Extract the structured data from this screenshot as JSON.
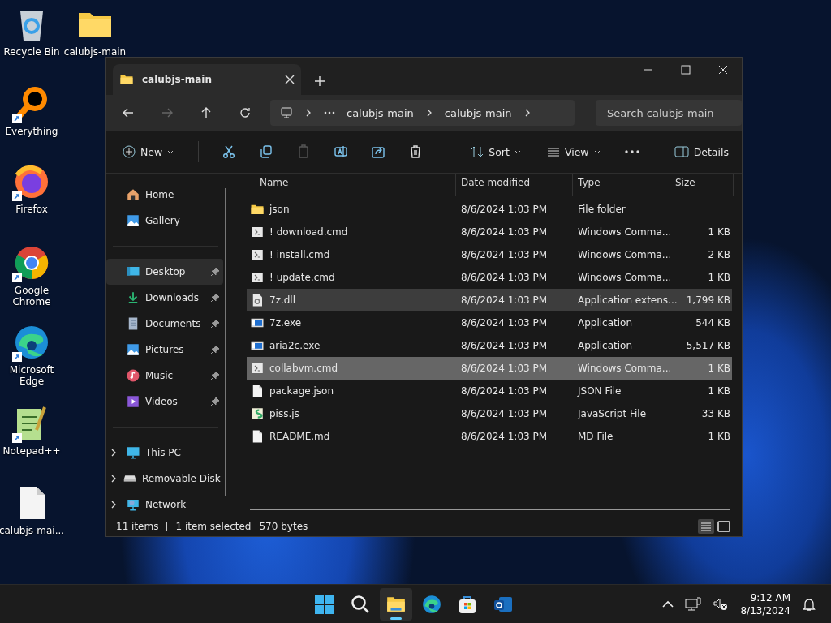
{
  "desktop_icons": [
    {
      "label": "Recycle Bin",
      "kind": "recycle",
      "shortcut": false
    },
    {
      "label": "calubjs-main",
      "kind": "folder",
      "shortcut": false
    },
    {
      "label": "Everything",
      "kind": "everything",
      "shortcut": true
    },
    {
      "label": "Firefox",
      "kind": "firefox",
      "shortcut": true
    },
    {
      "label": "Google Chrome",
      "kind": "chrome",
      "shortcut": true
    },
    {
      "label": "Microsoft Edge",
      "kind": "edge",
      "shortcut": true
    },
    {
      "label": "Notepad++",
      "kind": "notepad",
      "shortcut": true
    },
    {
      "label": "calubjs-mai...",
      "kind": "file",
      "shortcut": false
    }
  ],
  "window": {
    "tab_title": "calubjs-main",
    "breadcrumbs": [
      "calubjs-main",
      "calubjs-main"
    ],
    "search": {
      "placeholder": "Search calubjs-main"
    },
    "toolbar": {
      "new": "New",
      "sort": "Sort",
      "view": "View",
      "details": "Details"
    },
    "sidebar": [
      [
        {
          "label": "Home",
          "kind": "home",
          "pinned": false,
          "expandable": false,
          "selected": false
        },
        {
          "label": "Gallery",
          "kind": "gallery",
          "pinned": false,
          "expandable": false,
          "selected": false
        }
      ],
      [
        {
          "label": "Desktop",
          "kind": "desktop",
          "pinned": true,
          "expandable": false,
          "selected": true
        },
        {
          "label": "Downloads",
          "kind": "downloads",
          "pinned": true,
          "expandable": false,
          "selected": false
        },
        {
          "label": "Documents",
          "kind": "documents",
          "pinned": true,
          "expandable": false,
          "selected": false
        },
        {
          "label": "Pictures",
          "kind": "gallery",
          "pinned": true,
          "expandable": false,
          "selected": false
        },
        {
          "label": "Music",
          "kind": "music",
          "pinned": true,
          "expandable": false,
          "selected": false
        },
        {
          "label": "Videos",
          "kind": "videos",
          "pinned": true,
          "expandable": false,
          "selected": false
        }
      ],
      [
        {
          "label": "This PC",
          "kind": "pc",
          "pinned": false,
          "expandable": true,
          "selected": false
        },
        {
          "label": "Removable Disk",
          "kind": "disk",
          "pinned": false,
          "expandable": true,
          "selected": false
        },
        {
          "label": "Network",
          "kind": "network",
          "pinned": false,
          "expandable": true,
          "selected": false
        }
      ]
    ],
    "columns": [
      "Name",
      "Date modified",
      "Type",
      "Size"
    ],
    "rows": [
      {
        "name": "json",
        "kind": "folder",
        "date": "8/6/2024 1:03 PM",
        "type": "File folder",
        "size": "",
        "selected": false,
        "hovered": false
      },
      {
        "name": "! download.cmd",
        "kind": "cmd",
        "date": "8/6/2024 1:03 PM",
        "type": "Windows Comma...",
        "size": "1 KB",
        "selected": false,
        "hovered": false
      },
      {
        "name": "! install.cmd",
        "kind": "cmd",
        "date": "8/6/2024 1:03 PM",
        "type": "Windows Comma...",
        "size": "2 KB",
        "selected": false,
        "hovered": false
      },
      {
        "name": "! update.cmd",
        "kind": "cmd",
        "date": "8/6/2024 1:03 PM",
        "type": "Windows Comma...",
        "size": "1 KB",
        "selected": false,
        "hovered": false
      },
      {
        "name": "7z.dll",
        "kind": "dll",
        "date": "8/6/2024 1:03 PM",
        "type": "Application extens...",
        "size": "1,799 KB",
        "selected": false,
        "hovered": true
      },
      {
        "name": "7z.exe",
        "kind": "exe",
        "date": "8/6/2024 1:03 PM",
        "type": "Application",
        "size": "544 KB",
        "selected": false,
        "hovered": false
      },
      {
        "name": "aria2c.exe",
        "kind": "exe",
        "date": "8/6/2024 1:03 PM",
        "type": "Application",
        "size": "5,517 KB",
        "selected": false,
        "hovered": false
      },
      {
        "name": "collabvm.cmd",
        "kind": "cmd",
        "date": "8/6/2024 1:03 PM",
        "type": "Windows Comma...",
        "size": "1 KB",
        "selected": true,
        "hovered": false
      },
      {
        "name": "package.json",
        "kind": "file",
        "date": "8/6/2024 1:03 PM",
        "type": "JSON File",
        "size": "1 KB",
        "selected": false,
        "hovered": false
      },
      {
        "name": "piss.js",
        "kind": "js",
        "date": "8/6/2024 1:03 PM",
        "type": "JavaScript File",
        "size": "33 KB",
        "selected": false,
        "hovered": false
      },
      {
        "name": "README.md",
        "kind": "file",
        "date": "8/6/2024 1:03 PM",
        "type": "MD File",
        "size": "1 KB",
        "selected": false,
        "hovered": false
      }
    ],
    "status": {
      "count": "11 items",
      "selection": "1 item selected",
      "size": "570 bytes"
    }
  },
  "taskbar": {
    "apps": [
      {
        "kind": "start",
        "active": false
      },
      {
        "kind": "search",
        "active": false
      },
      {
        "kind": "explorer",
        "active": true
      },
      {
        "kind": "edge",
        "active": false
      },
      {
        "kind": "store",
        "active": false
      },
      {
        "kind": "outlook",
        "active": false
      }
    ],
    "time": "9:12 AM",
    "date": "8/13/2024"
  }
}
